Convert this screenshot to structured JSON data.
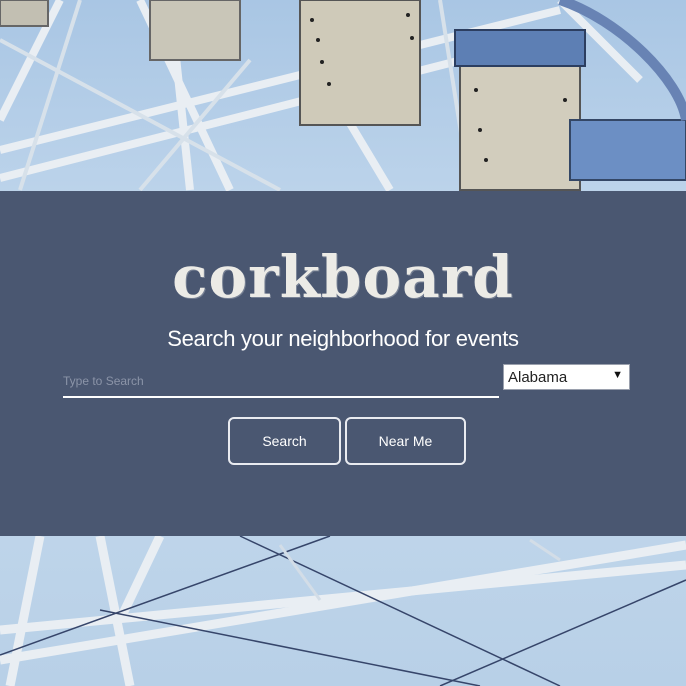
{
  "header": {
    "brand": "corkboard",
    "tagline": "Search your neighborhood for events"
  },
  "search": {
    "placeholder": "Type to Search",
    "value": ""
  },
  "state_select": {
    "selected": "Alabama",
    "arrow_icon": "triangle-down-icon"
  },
  "buttons": {
    "search_label": "Search",
    "near_me_label": "Near Me"
  },
  "colors": {
    "panel": "#4a5771",
    "text": "#ffffff"
  }
}
